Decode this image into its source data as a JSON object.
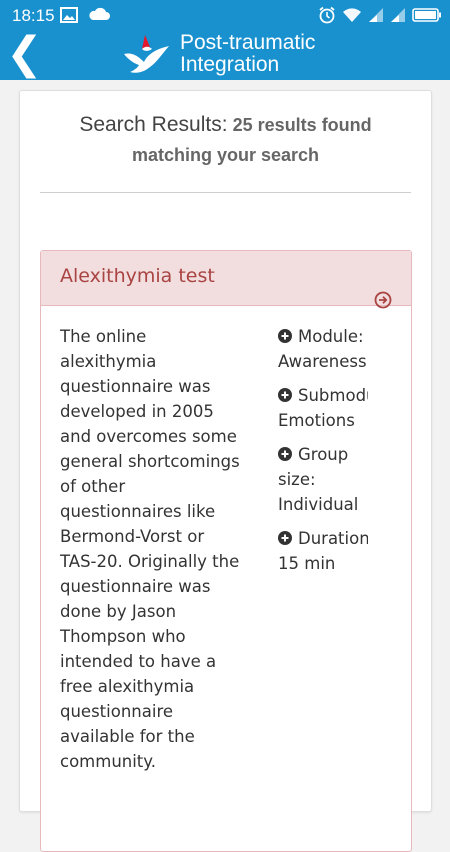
{
  "status_bar": {
    "time": "18:15",
    "icons_left": [
      "image-icon",
      "cloud-icon"
    ],
    "icons_right": [
      "alarm-icon",
      "wifi-icon",
      "signal-icon",
      "signal-icon",
      "battery-icon"
    ]
  },
  "header": {
    "back_glyph": "❮",
    "brand_line1": "Post-traumatic",
    "brand_line2": "Integration",
    "color": "#1991cf"
  },
  "search": {
    "title": "Search Results:",
    "count_text": "25 results found",
    "line2": "matching your search"
  },
  "result": {
    "title": "Alexithymia test",
    "description_lines": [
      "The online",
      "alexithymia",
      "questionnaire was",
      "developed in 2005",
      "and overcomes some",
      "general shortcomings",
      "of other",
      "questionnaires like",
      "Bermond-Vorst or",
      "TAS-20. Originally the",
      "questionnaire was",
      "done by Jason",
      "Thompson who",
      "intended to have a",
      "free alexithymia",
      "questionnaire",
      "available for the",
      "community."
    ],
    "meta": [
      {
        "label": "Module:",
        "value": "Awareness"
      },
      {
        "label": "Submodule:",
        "value": "Emotions"
      },
      {
        "label": "Group size:",
        "value": "Individual"
      },
      {
        "label": "Duration:",
        "value": "15 min"
      }
    ],
    "accent": "#a94442",
    "heading_bg": "#f2dede"
  }
}
